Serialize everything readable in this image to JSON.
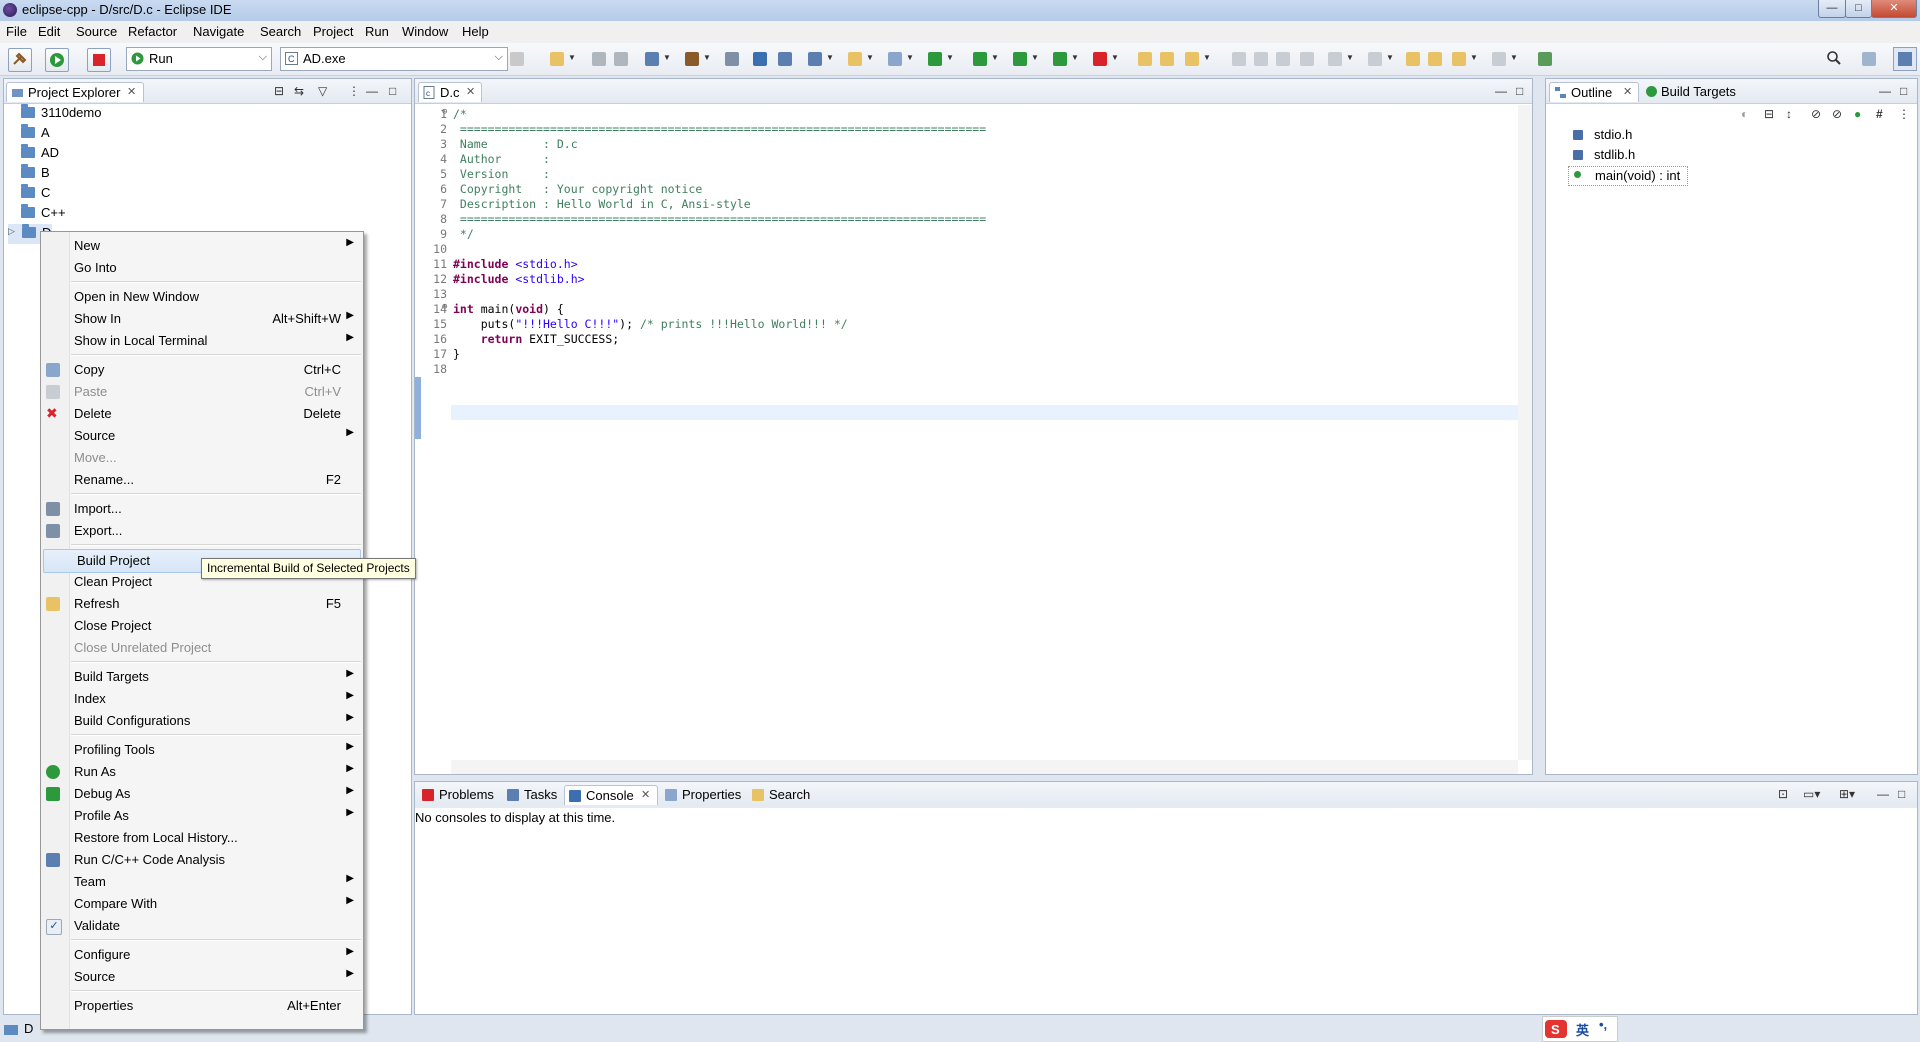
{
  "window": {
    "title": "eclipse-cpp - D/src/D.c - Eclipse IDE",
    "min": "—",
    "max": "□",
    "close": "✕"
  },
  "menubar": [
    "File",
    "Edit",
    "Source",
    "Refactor",
    "Navigate",
    "Search",
    "Project",
    "Run",
    "Window",
    "Help"
  ],
  "toolbar": {
    "launch_mode": "Run",
    "launch_config": "AD.exe"
  },
  "project_explorer": {
    "tab_label": "Project Explorer",
    "items": [
      "3110demo",
      "A",
      "AD",
      "B",
      "C",
      "C++",
      "D"
    ],
    "status_label": "D"
  },
  "editor": {
    "tab_label": "D.c",
    "lines": [
      {
        "n": "1",
        "fold": "⊖",
        "text": "/*"
      },
      {
        "n": "2",
        "text": " ============================================================================"
      },
      {
        "n": "3",
        "text": " Name        : D.c"
      },
      {
        "n": "4",
        "text": " Author      : "
      },
      {
        "n": "5",
        "text": " Version     :"
      },
      {
        "n": "6",
        "text": " Copyright   : Your copyright notice"
      },
      {
        "n": "7",
        "text": " Description : Hello World in C, Ansi-style"
      },
      {
        "n": "8",
        "text": " ============================================================================"
      },
      {
        "n": "9",
        "text": " */"
      },
      {
        "n": "10",
        "text": ""
      },
      {
        "n": "11",
        "kw": "#include",
        "rest": " <stdio.h>"
      },
      {
        "n": "12",
        "kw": "#include",
        "rest": " <stdlib.h>"
      },
      {
        "n": "13",
        "text": ""
      },
      {
        "n": "14",
        "fold": "⊖",
        "code": "int main(void) {"
      },
      {
        "n": "15",
        "code": "    puts(\"!!!Hello C!!!\"); /* prints !!!Hello World!!! */"
      },
      {
        "n": "16",
        "code": "    return EXIT_SUCCESS;"
      },
      {
        "n": "17",
        "code": "}"
      },
      {
        "n": "18",
        "code": ""
      }
    ]
  },
  "outline": {
    "tab_outline": "Outline",
    "tab_build_targets": "Build Targets",
    "items": [
      "stdio.h",
      "stdlib.h",
      "main(void) : int"
    ]
  },
  "bottom_panel": {
    "tabs": [
      "Problems",
      "Tasks",
      "Console",
      "Properties",
      "Search"
    ],
    "active_tab": "Console",
    "message": "No consoles to display at this time."
  },
  "context_menu": {
    "groups": [
      [
        {
          "label": "New",
          "submenu": true
        },
        {
          "label": "Go Into"
        }
      ],
      [
        {
          "label": "Open in New Window"
        },
        {
          "label": "Show In",
          "accel": "Alt+Shift+W",
          "submenu": true
        },
        {
          "label": "Show in Local Terminal",
          "submenu": true
        }
      ],
      [
        {
          "label": "Copy",
          "accel": "Ctrl+C",
          "icon": "copy-icon"
        },
        {
          "label": "Paste",
          "accel": "Ctrl+V",
          "disabled": true,
          "icon": "paste-icon"
        },
        {
          "label": "Delete",
          "accel": "Delete",
          "icon": "delete-icon"
        },
        {
          "label": "Source",
          "submenu": true
        },
        {
          "label": "Move...",
          "disabled": true
        },
        {
          "label": "Rename...",
          "accel": "F2"
        }
      ],
      [
        {
          "label": "Import...",
          "icon": "import-icon"
        },
        {
          "label": "Export...",
          "icon": "export-icon"
        }
      ],
      [
        {
          "label": "Build Project",
          "highlighted": true
        },
        {
          "label": "Clean Project"
        },
        {
          "label": "Refresh",
          "accel": "F5",
          "icon": "refresh-icon"
        },
        {
          "label": "Close Project"
        },
        {
          "label": "Close Unrelated Project",
          "disabled": true
        }
      ],
      [
        {
          "label": "Build Targets",
          "submenu": true
        },
        {
          "label": "Index",
          "submenu": true
        },
        {
          "label": "Build Configurations",
          "submenu": true
        }
      ],
      [
        {
          "label": "Profiling Tools",
          "submenu": true
        },
        {
          "label": "Run As",
          "submenu": true,
          "icon": "run-icon"
        },
        {
          "label": "Debug As",
          "submenu": true,
          "icon": "debug-icon"
        },
        {
          "label": "Profile As",
          "submenu": true
        },
        {
          "label": "Restore from Local History..."
        },
        {
          "label": "Run C/C++ Code Analysis",
          "icon": "code-analysis-icon"
        },
        {
          "label": "Team",
          "submenu": true
        },
        {
          "label": "Compare With",
          "submenu": true
        },
        {
          "label": "Validate",
          "icon": "check-icon"
        }
      ],
      [
        {
          "label": "Configure",
          "submenu": true
        },
        {
          "label": "Source",
          "submenu": true
        }
      ],
      [
        {
          "label": "Properties",
          "accel": "Alt+Enter"
        }
      ]
    ]
  },
  "tooltip": "Incremental Build of Selected Projects",
  "ime": {
    "label": "英"
  },
  "colors": {
    "accent": "#3875d7",
    "menu_highlight": "#d6e5f7",
    "keyword": "#7f0055",
    "comment": "#3f7f5f",
    "string": "#2a00ff"
  }
}
